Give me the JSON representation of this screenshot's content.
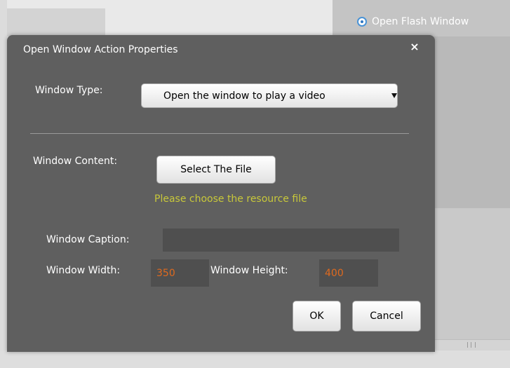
{
  "background": {
    "radio_label": "Open Flash Window",
    "radio_selected": true
  },
  "dialog": {
    "title": "Open Window Action Properties",
    "close_glyph": "×",
    "window_type": {
      "label": "Window Type:",
      "selected_value": "Open the window to play a video"
    },
    "window_content": {
      "label": "Window Content:",
      "button_label": "Select The File",
      "hint": "Please choose the resource file"
    },
    "window_caption": {
      "label": "Window Caption:",
      "value": ""
    },
    "window_width": {
      "label": "Window Width:",
      "value": "350"
    },
    "window_height": {
      "label": "Window Height:",
      "value": "400"
    },
    "ok_label": "OK",
    "cancel_label": "Cancel"
  },
  "colors": {
    "dialog_bg": "#5f5f5f",
    "hint_text": "#c8c83a",
    "numeric_value": "#e06a1e",
    "field_bg": "#4f4f4f"
  },
  "icons": {
    "radio": "radio-selected-icon",
    "close": "close-icon",
    "dropdown": "dropdown-arrow-icon"
  }
}
